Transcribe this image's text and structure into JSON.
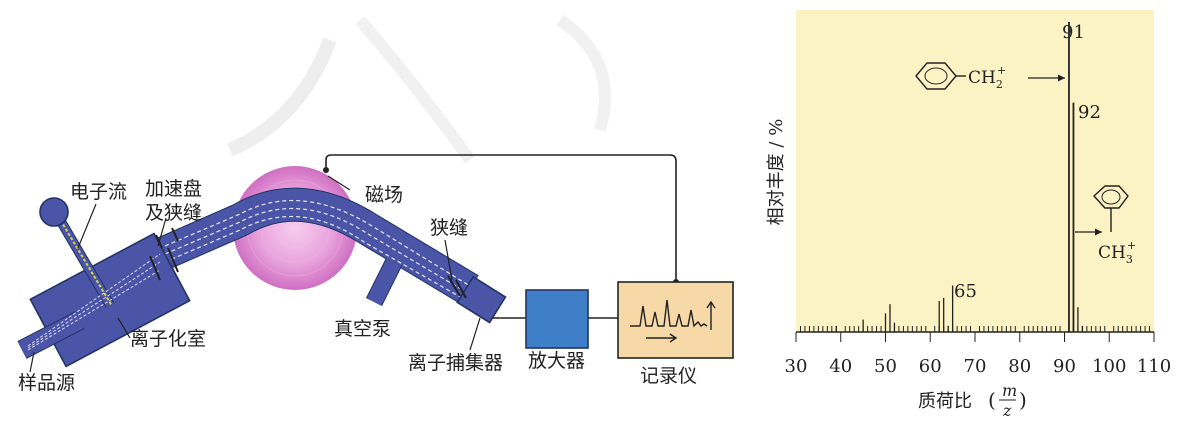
{
  "diagram": {
    "labels": {
      "electron_stream": "电子流",
      "accel_plate_line1": "加速盘",
      "accel_plate_line2": "及狭缝",
      "magnetic_field": "磁场",
      "slit": "狭缝",
      "vacuum_pump": "真空泵",
      "ionization_chamber": "离子化室",
      "sample_source": "样品源",
      "ion_collector": "离子捕集器",
      "amplifier": "放大器",
      "recorder": "记录仪"
    }
  },
  "chart_data": {
    "type": "bar",
    "ylabel": "相对丰度 / %",
    "xlabel_prefix": "质荷比",
    "xlabel_fraction_num": "m",
    "xlabel_fraction_den": "z",
    "xlim": [
      30,
      110
    ],
    "x_ticks": [
      30,
      40,
      50,
      60,
      70,
      80,
      90,
      100,
      110
    ],
    "x_tick_labels": [
      "30",
      "40",
      "50",
      "60",
      "70",
      "80",
      "90",
      "100",
      "110"
    ],
    "grid": false,
    "peaks": [
      {
        "x": 39,
        "y": 2
      },
      {
        "x": 45,
        "y": 4
      },
      {
        "x": 50,
        "y": 6
      },
      {
        "x": 51,
        "y": 9
      },
      {
        "x": 52,
        "y": 3
      },
      {
        "x": 62,
        "y": 10
      },
      {
        "x": 63,
        "y": 11
      },
      {
        "x": 64,
        "y": 2
      },
      {
        "x": 65,
        "y": 15
      },
      {
        "x": 91,
        "y": 100
      },
      {
        "x": 92,
        "y": 74
      },
      {
        "x": 93,
        "y": 8
      },
      {
        "x": 94,
        "y": 2
      }
    ],
    "peak_labels": [
      {
        "x": 91,
        "text": "91"
      },
      {
        "x": 92,
        "text": "92"
      },
      {
        "x": 65,
        "text": "65"
      }
    ],
    "annotations": [
      {
        "formula_main": "CH",
        "formula_sub": "2",
        "formula_sup": "+"
      },
      {
        "formula_main": "CH",
        "formula_sub": "3",
        "formula_sup": "+"
      }
    ]
  }
}
